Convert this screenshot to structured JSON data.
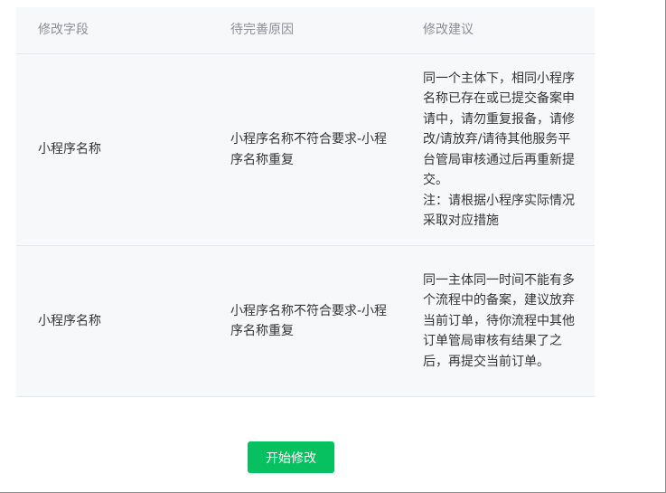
{
  "table": {
    "headers": [
      "修改字段",
      "待完善原因",
      "修改建议"
    ],
    "rows": [
      {
        "field": "小程序名称",
        "reason": "小程序名称不符合要求-小程序名称重复",
        "suggestion": "同一个主体下，相同小程序名称已存在或已提交备案申请中，请勿重复报备，请修改/请放弃/请待其他服务平台管局审核通过后再重新提交。",
        "note": "注：请根据小程序实际情况采取对应措施"
      },
      {
        "field": "小程序名称",
        "reason": "小程序名称不符合要求-小程序名称重复",
        "suggestion": "同一主体同一时间不能有多个流程中的备案，建议放弃当前订单，待你流程中其他订单管局审核有结果了之后，再提交当前订单。"
      }
    ]
  },
  "actions": {
    "start_label": "开始修改"
  },
  "colors": {
    "primary": "#07c160",
    "table_bg": "#f7f8fa",
    "header_text": "#8a8f99",
    "body_text": "#353535"
  }
}
